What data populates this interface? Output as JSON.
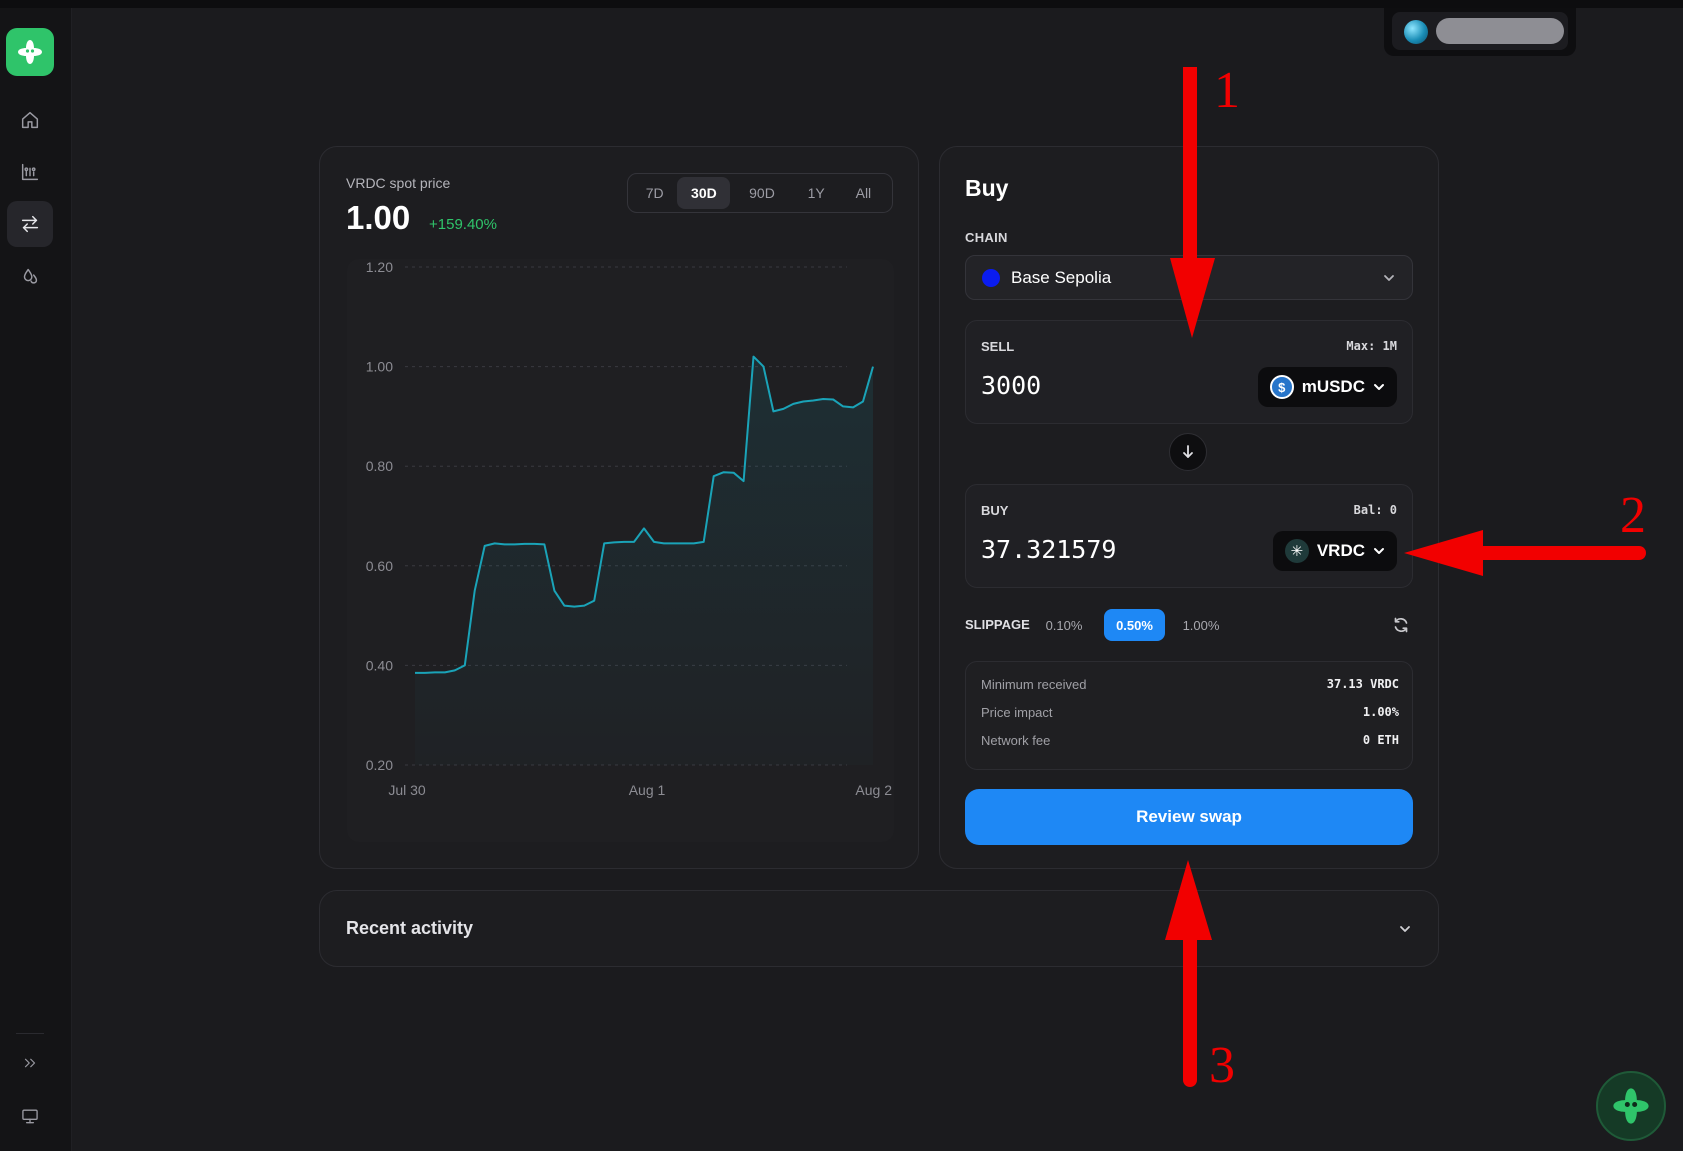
{
  "sidebar": {
    "items": [
      {
        "name": "home",
        "icon": "home-icon",
        "active": false
      },
      {
        "name": "markets",
        "icon": "chart-icon",
        "active": false
      },
      {
        "name": "swap",
        "icon": "swap-arrows-icon",
        "active": true
      },
      {
        "name": "liquidity",
        "icon": "drops-icon",
        "active": false
      }
    ],
    "bottom": [
      {
        "name": "expand",
        "icon": "double-chevron-right-icon"
      },
      {
        "name": "display",
        "icon": "monitor-icon"
      }
    ]
  },
  "colors": {
    "accent": "#1e88f5",
    "positive": "#2fc46a",
    "brand": "#2fc46a",
    "line": "#1aa3b8",
    "annotation": "#f20000"
  },
  "price_panel": {
    "label": "VRDC spot price",
    "price": "1.00",
    "change": "+159.40%",
    "ranges": [
      "7D",
      "30D",
      "90D",
      "1Y",
      "All"
    ],
    "active_range": "30D"
  },
  "chart_data": {
    "type": "area",
    "y_ticks": [
      "1.20",
      "1.00",
      "0.80",
      "0.60",
      "0.40",
      "0.20"
    ],
    "x_ticks": [
      "Jul 30",
      "Aug 1",
      "Aug 2"
    ],
    "ylim": [
      0.2,
      1.2
    ],
    "grid": true,
    "series": [
      {
        "values": [
          0.385,
          0.385,
          0.386,
          0.386,
          0.39,
          0.4,
          0.55,
          0.64,
          0.645,
          0.643,
          0.643,
          0.644,
          0.644,
          0.643,
          0.55,
          0.52,
          0.518,
          0.52,
          0.53,
          0.645,
          0.647,
          0.648,
          0.648,
          0.675,
          0.648,
          0.645,
          0.645,
          0.645,
          0.645,
          0.648,
          0.78,
          0.788,
          0.787,
          0.77,
          1.02,
          1.0,
          0.91,
          0.915,
          0.925,
          0.93,
          0.932,
          0.935,
          0.934,
          0.92,
          0.918,
          0.93,
          1.0
        ]
      }
    ]
  },
  "swap": {
    "title": "Buy",
    "chain_label": "CHAIN",
    "chain": "Base Sepolia",
    "chain_color": "#0a1cf0",
    "sell": {
      "label": "SELL",
      "meta": "Max: 1M",
      "amount": "3000",
      "token": "mUSDC",
      "icon": "usdc-icon"
    },
    "buy": {
      "label": "BUY",
      "meta": "Bal: 0",
      "amount": "37.321579",
      "token": "VRDC",
      "icon": "vrdc-icon"
    },
    "slippage_label": "SLIPPAGE",
    "slippage_options": [
      "0.10%",
      "0.50%",
      "1.00%"
    ],
    "slippage_active": "0.50%",
    "details": [
      {
        "key": "Minimum received",
        "value": "37.13 VRDC"
      },
      {
        "key": "Price impact",
        "value": "1.00%"
      },
      {
        "key": "Network fee",
        "value": "0 ETH"
      }
    ],
    "review_label": "Review swap"
  },
  "activity": {
    "title": "Recent activity"
  },
  "annotations": [
    "1",
    "2",
    "3"
  ]
}
